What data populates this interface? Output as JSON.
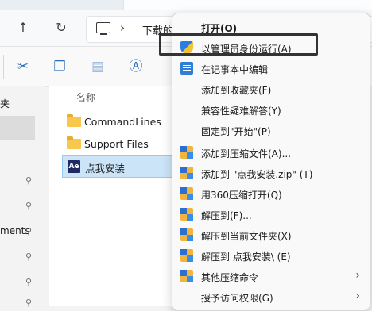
{
  "explorer": {
    "address_label": "下载的"
  },
  "sidebar": {
    "items": [
      {
        "label": "夹"
      },
      {
        "label": "ments"
      }
    ]
  },
  "content": {
    "column_name": "名称",
    "files": [
      {
        "name": "CommandLines",
        "type": "folder"
      },
      {
        "name": "Support Files",
        "type": "folder"
      },
      {
        "name": "点我安装",
        "type": "exe",
        "selected": true
      }
    ]
  },
  "context_menu": {
    "items": [
      {
        "label": "打开(O)",
        "bold": true,
        "icon": "none"
      },
      {
        "label": "以管理员身份运行(A)",
        "icon": "shield-icon"
      },
      {
        "label": "在记事本中编辑",
        "icon": "notepad-icon"
      },
      {
        "label": "添加到收藏夹(F)",
        "icon": "none"
      },
      {
        "label": "兼容性疑难解答(Y)",
        "icon": "none"
      },
      {
        "label": "固定到\"开始\"(P)",
        "icon": "none"
      },
      {
        "label": "添加到压缩文件(A)...",
        "icon": "zip-icon"
      },
      {
        "label": "添加到 \"点我安装.zip\" (T)",
        "icon": "zip-icon"
      },
      {
        "label": "用360压缩打开(Q)",
        "icon": "zip-icon"
      },
      {
        "label": "解压到(F)...",
        "icon": "zip-icon"
      },
      {
        "label": "解压到当前文件夹(X)",
        "icon": "zip-icon"
      },
      {
        "label": "解压到 点我安装\\ (E)",
        "icon": "zip-icon"
      },
      {
        "label": "其他压缩命令",
        "icon": "zip-icon",
        "submenu": true
      },
      {
        "label": "授予访问权限(G)",
        "icon": "none",
        "submenu": true
      }
    ]
  },
  "colors": {
    "menu_bg": "#f9f9f9",
    "selection": "#cce4f7",
    "folder": "#f8c74b"
  }
}
